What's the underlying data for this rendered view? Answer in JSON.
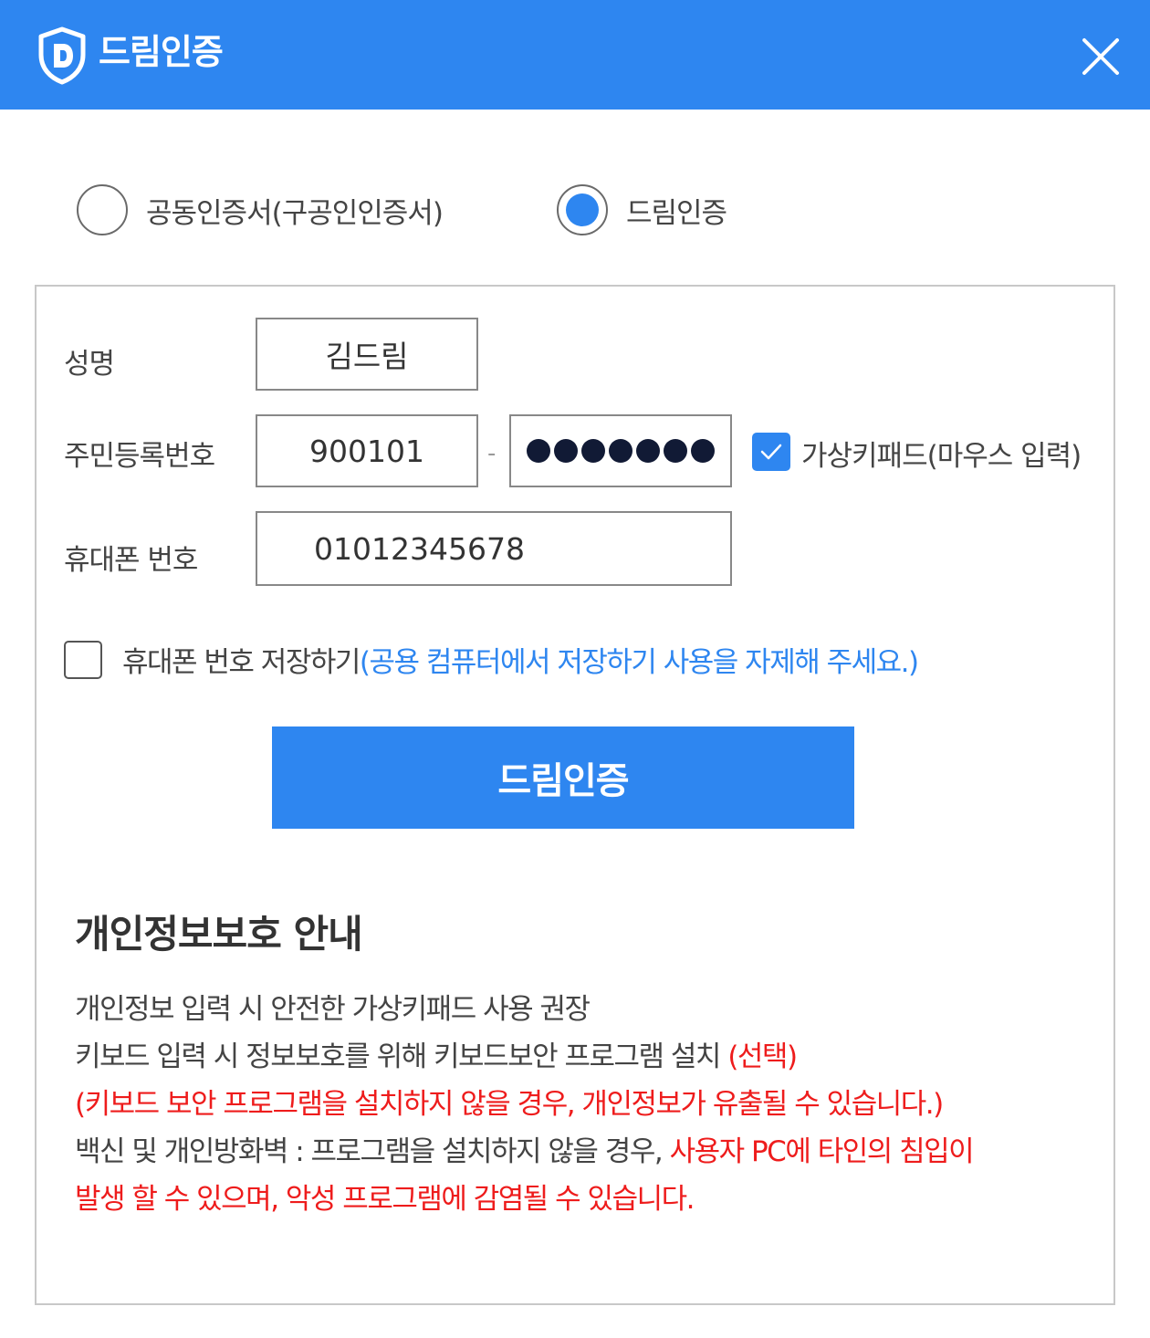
{
  "header": {
    "title": "드림인증",
    "logo_icon": "shield-d-icon",
    "close_icon": "close-icon",
    "bg_color": "#2e86f0"
  },
  "auth_type": {
    "options": [
      {
        "label": "공동인증서(구공인인증서)",
        "selected": false
      },
      {
        "label": "드림인증",
        "selected": true
      }
    ]
  },
  "form": {
    "name_label": "성명",
    "name_value": "김드림",
    "rrn_label": "주민등록번호",
    "rrn_front": "900101",
    "rrn_separator": "-",
    "rrn_back_masked_count": 7,
    "virtual_keypad_checked": true,
    "virtual_keypad_label": "가상키패드(마우스 입력)",
    "phone_label": "휴대폰 번호",
    "phone_value": "01012345678",
    "save_phone_checked": false,
    "save_phone_label": "휴대폰 번호 저장하기",
    "save_phone_note": "(공용 컴퓨터에서 저장하기 사용을 자제해 주세요.)",
    "submit_label": "드림인증"
  },
  "privacy": {
    "title": "개인정보보호 안내",
    "line1": "개인정보 입력 시 안전한 가상키패드 사용 권장",
    "line2_text": "키보드 입력 시 정보보호를 위해 키보드보안 프로그램 설치 ",
    "line2_red": "(선택)",
    "line3_red": "(키보드 보안 프로그램을 설치하지 않을 경우, 개인정보가 유출될 수 있습니다.)",
    "line4_text": "백신 및 개인방화벽 : 프로그램을 설치하지 않을 경우, ",
    "line4_red": "사용자 PC에 타인의 침입이",
    "line5_red": "발생 할 수 있으며, 악성 프로그램에 감염될 수 있습니다."
  }
}
